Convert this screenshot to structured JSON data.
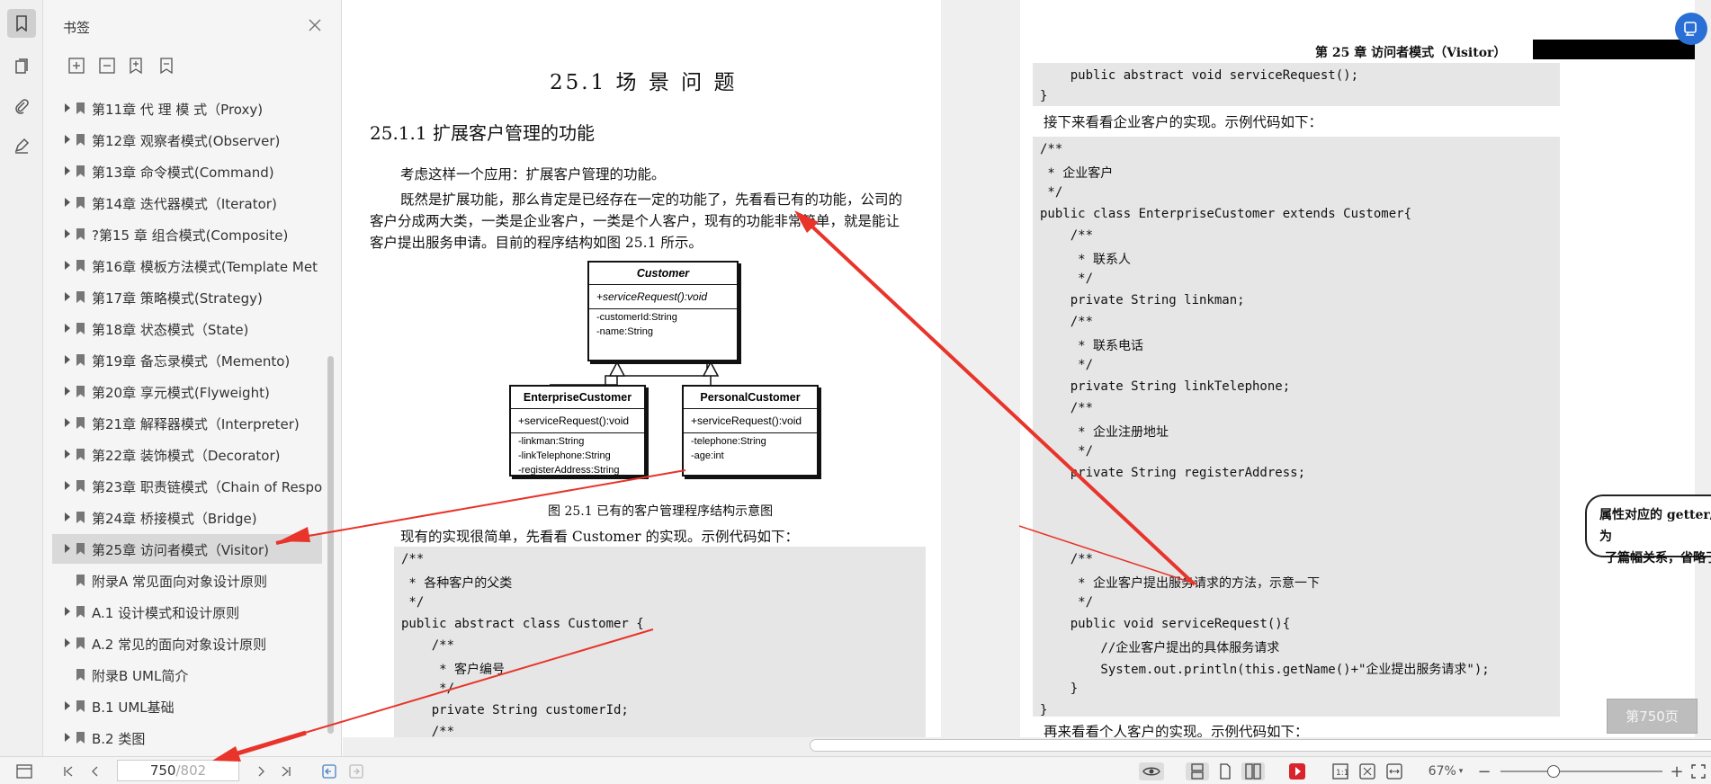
{
  "sidebar": {
    "title": "书签",
    "items": [
      {
        "label": "第11章 代 理 模 式（Proxy)",
        "arrow": true
      },
      {
        "label": "第12章 观察者模式(Observer)",
        "arrow": true
      },
      {
        "label": "第13章 命令模式(Command)",
        "arrow": true
      },
      {
        "label": "第14章 迭代器模式（Iterator)",
        "arrow": true
      },
      {
        "label": "?第15 章 组合模式(Composite)",
        "arrow": true
      },
      {
        "label": "第16章 模板方法模式(Template Met",
        "arrow": true
      },
      {
        "label": "第17章 策略模式(Strategy)",
        "arrow": true
      },
      {
        "label": "第18章 状态模式（State)",
        "arrow": true
      },
      {
        "label": "第19章 备忘录模式（Memento)",
        "arrow": true
      },
      {
        "label": "第20章 享元模式(Flyweight)",
        "arrow": true
      },
      {
        "label": "第21章 解释器模式（Interpreter)",
        "arrow": true
      },
      {
        "label": "第22章 装饰模式（Decorator)",
        "arrow": true
      },
      {
        "label": "第23章 职责链模式（Chain of Respo",
        "arrow": true
      },
      {
        "label": "第24章 桥接模式（Bridge)",
        "arrow": true
      },
      {
        "label": "第25章 访问者模式（Visitor)",
        "arrow": true,
        "selected": true
      },
      {
        "label": "附录A 常见面向对象设计原则",
        "arrow": false
      },
      {
        "label": "A.1 设计模式和设计原则",
        "arrow": true
      },
      {
        "label": "A.2 常见的面向对象设计原则",
        "arrow": true
      },
      {
        "label": "附录B UML简介",
        "arrow": false
      },
      {
        "label": "B.1 UML基础",
        "arrow": true
      },
      {
        "label": "B.2 类图",
        "arrow": true
      }
    ]
  },
  "left_page": {
    "section_title": "25.1  场 景 问 题",
    "subsection_title": "25.1.1   扩展客户管理的功能",
    "para1": "考虑这样一个应用：扩展客户管理的功能。",
    "para2_line1": "既然是扩展功能，那么肯定是已经存在一定的功能了，先看看已有的功能，公司的",
    "para2_line2": "客户分成两大类，一类是企业客户，一类是个人客户，现有的功能非常简单，就是能让",
    "para2_line3": "客户提出服务申请。目前的程序结构如图 25.1 所示。",
    "uml": {
      "customer": {
        "name": "Customer",
        "op": "+serviceRequest():void",
        "attrs": [
          "-customerId:String",
          "-name:String"
        ]
      },
      "enterprise": {
        "name": "EnterpriseCustomer",
        "op": "+serviceRequest():void",
        "attrs": [
          "-linkman:String",
          "-linkTelephone:String",
          "-registerAddress:String"
        ]
      },
      "personal": {
        "name": "PersonalCustomer",
        "op": "+serviceRequest():void",
        "attrs": [
          "-telephone:String",
          "-age:int"
        ]
      }
    },
    "figure_caption": "图 25.1    已有的客户管理程序结构示意图",
    "para3": "现有的实现很简单，先看看 Customer 的实现。示例代码如下：",
    "code": [
      "/**",
      " * 各种客户的父类",
      " */",
      "public abstract class Customer {",
      "    /**",
      "     * 客户编号",
      "     */",
      "    private String customerId;",
      "    /**"
    ]
  },
  "right_page": {
    "chapter_header": "第 25 章   访问者模式（Visitor）",
    "top_code": [
      "    public abstract void serviceRequest();",
      "}"
    ],
    "para1": "接下来看看企业客户的实现。示例代码如下：",
    "code": [
      "/**",
      " * 企业客户",
      " */",
      "public class EnterpriseCustomer extends Customer{",
      "    /**",
      "     * 联系人",
      "     */",
      "    private String linkman;",
      "    /**",
      "     * 联系电话",
      "     */",
      "    private String linkTelephone;",
      "    /**",
      "     * 企业注册地址",
      "     */",
      "    private String registerAddress;",
      "",
      "",
      "    /**",
      "     * 企业客户提出服务请求的方法，示意一下",
      "     */",
      "    public void serviceRequest(){",
      "        //企业客户提出的具体服务请求",
      "        System.out.println(this.getName()+\"企业提出服务请求\");",
      "    }",
      "}"
    ],
    "callout_line1": "属性对应的 getter/setter 方法，为",
    "callout_line2": "了篇幅关系，省略了",
    "para2": "再来看看个人客户的实现。示例代码如下："
  },
  "page_badge": "第750页",
  "nav": {
    "current_page": "750",
    "total_pages": "/802"
  },
  "zoom": "67%",
  "colors": {
    "annotation_red": "#e8342a",
    "accent_blue": "#2a6fd6",
    "play_red": "#d9232d"
  }
}
